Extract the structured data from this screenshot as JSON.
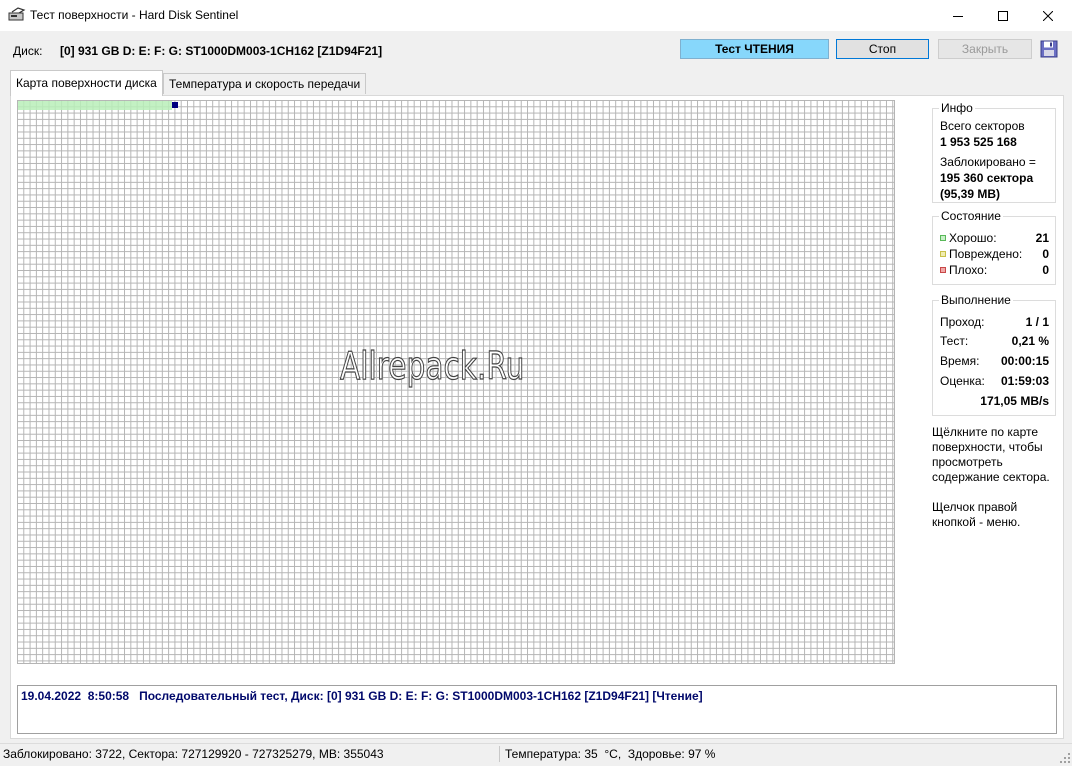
{
  "window": {
    "title": "Тест поверхности - Hard Disk Sentinel",
    "icons": [
      "app-icon",
      "minimize-icon",
      "maximize-icon",
      "close-icon"
    ]
  },
  "disk": {
    "label": "Диск:",
    "value": "[0] 931 GB D: E: F: G: ST1000DM003-1CH162 [Z1D94F21]"
  },
  "toolbar": {
    "read_test_label": "Тест ЧТЕНИЯ",
    "stop_label": "Стоп",
    "close_label": "Закрыть",
    "save_icon": "floppy-disk-icon",
    "read_color": "#87d7fb"
  },
  "tabs": [
    {
      "label": "Карта поверхности диска",
      "active": true
    },
    {
      "label": "Температура и скорость передачи",
      "active": false
    }
  ],
  "surface_map": {
    "watermark": "Allrepack.Ru",
    "good_color": "#b8efb8",
    "current_color": "#000080"
  },
  "info": {
    "title": "Инфо",
    "total_label": "Всего секторов",
    "total_value": "1 953 525 168",
    "blocked_label": "Заблокировано =",
    "blocked_value": "195 360 сектора",
    "blocked_mb": "(95,39 MB)"
  },
  "state": {
    "title": "Состояние",
    "items": [
      {
        "label": "Хорошо:",
        "value": "21",
        "color": "#7fd67f"
      },
      {
        "label": "Повреждено:",
        "value": "0",
        "color": "#e8e07a"
      },
      {
        "label": "Плохо:",
        "value": "0",
        "color": "#e07a7a"
      }
    ]
  },
  "progress": {
    "title": "Выполнение",
    "rows": [
      {
        "label": "Проход:",
        "value": "1 / 1"
      },
      {
        "label": "Тест:",
        "value": "0,21 %"
      },
      {
        "label": "Время:",
        "value": "00:00:15"
      },
      {
        "label": "Оценка:",
        "value": "01:59:03"
      }
    ],
    "speed": "171,05 MB/s"
  },
  "hints": {
    "click": "Щёлкните по карте поверхности, чтобы просмотреть содержание сектора.",
    "right_click": "Щелчок правой кнопкой - меню."
  },
  "log": {
    "text": "19.04.2022  8:50:58   Последовательный тест, Диск: [0] 931 GB D: E: F: G: ST1000DM003-1CH162 [Z1D94F21] [Чтение]"
  },
  "status": {
    "left": "Заблокировано: 3722, Сектора: 727129920 - 727325279, MB: 355043",
    "right": "Температура: 35  °C,  Здоровье: 97 %"
  }
}
